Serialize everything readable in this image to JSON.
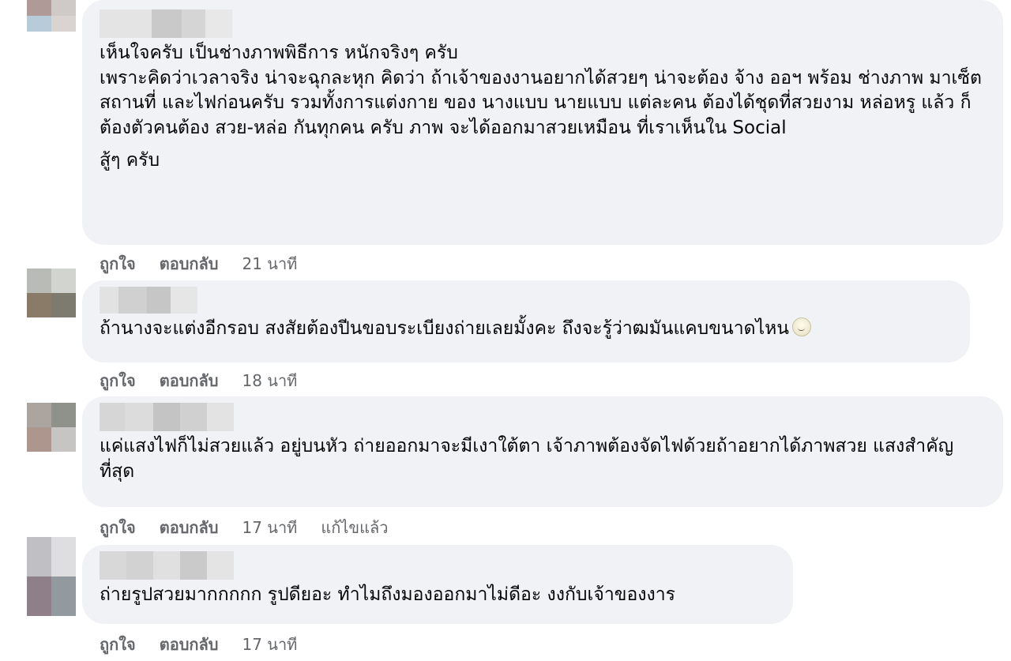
{
  "comments": [
    {
      "paragraphs": [
        "เห็นใจครับ เป็นช่างภาพพิธีการ หนักจริงๆ ครับ\nเพราะคิดว่าเวลาจริง น่าจะฉุกละหุก คิดว่า ถ้าเจ้าของงานอยากได้สวยๆ น่าจะต้อง จ้าง ออฯ พร้อม ช่างภาพ มาเซ็ตสถานที่ และไฟก่อนครับ รวมทั้งการแต่งกาย ของ นางแบบ นายแบบ แต่ละคน ต้องได้ชุดที่สวยงาม หล่อหรู แล้ว ก็ต้องตัวคนต้อง สวย-หล่อ กันทุกคน ครับ ภาพ จะได้ออกมาสวยเหมือน ที่เราเห็นใน Social",
        "สู้ๆ ครับ"
      ],
      "like_label": "ถูกใจ",
      "reply_label": "ตอบกลับ",
      "time": "21 นาที"
    },
    {
      "paragraphs": [
        "ถ้านางจะแต่งอีกรอบ สงสัยต้องปีนขอบระเบียงถ่ายเลยมั้งคะ ถึงจะรู้ว่าฒมันแคบขนาดไหน"
      ],
      "emoji": "slightly-smiling-face-icon",
      "like_label": "ถูกใจ",
      "reply_label": "ตอบกลับ",
      "time": "18 นาที"
    },
    {
      "paragraphs": [
        "แค่แสงไฟก็ไม่สวยแล้ว อยู่บนหัว ถ่ายออกมาจะมีเงาใต้ตา เจ้าภาพต้องจัดไฟด้วยถ้าอยากได้ภาพสวย แสงสำคัญที่สุด"
      ],
      "like_label": "ถูกใจ",
      "reply_label": "ตอบกลับ",
      "time": "17 นาที",
      "edited": "แก้ไขแล้ว"
    },
    {
      "paragraphs": [
        "ถ่ายรูปสวยมากกกกก รูปดียอะ ทำไมถึงมองออกมาไม่ดีอะ งงกับเจ้าของงาร"
      ],
      "like_label": "ถูกใจ",
      "reply_label": "ตอบกลับ",
      "time": "17 นาที"
    }
  ],
  "colors": {
    "bubble_bg": "#f0f2f5",
    "text": "#050505",
    "meta_text": "#65676b"
  }
}
